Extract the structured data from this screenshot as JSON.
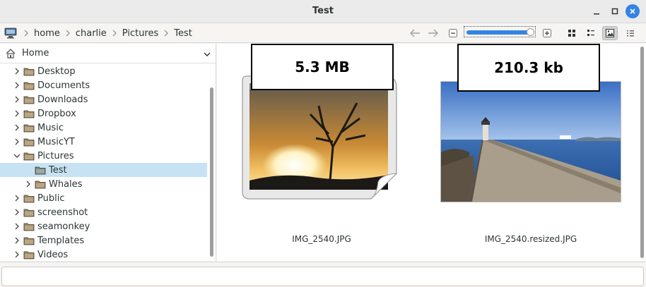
{
  "window": {
    "title": "Test"
  },
  "breadcrumb": [
    "home",
    "charlie",
    "Pictures",
    "Test"
  ],
  "zoom": {
    "level": 0.95
  },
  "sidebar": {
    "header": "Home",
    "items": [
      {
        "label": "Desktop",
        "depth": 1,
        "expanded": false,
        "selected": false
      },
      {
        "label": "Documents",
        "depth": 1,
        "expanded": false,
        "selected": false
      },
      {
        "label": "Downloads",
        "depth": 1,
        "expanded": false,
        "selected": false
      },
      {
        "label": "Dropbox",
        "depth": 1,
        "expanded": false,
        "selected": false
      },
      {
        "label": "Music",
        "depth": 1,
        "expanded": false,
        "selected": false
      },
      {
        "label": "MusicYT",
        "depth": 1,
        "expanded": false,
        "selected": false
      },
      {
        "label": "Pictures",
        "depth": 1,
        "expanded": true,
        "selected": false
      },
      {
        "label": "Test",
        "depth": 2,
        "expanded": null,
        "selected": true
      },
      {
        "label": "Whales",
        "depth": 2,
        "expanded": false,
        "selected": false
      },
      {
        "label": "Public",
        "depth": 1,
        "expanded": false,
        "selected": false
      },
      {
        "label": "screenshot",
        "depth": 1,
        "expanded": false,
        "selected": false
      },
      {
        "label": "seamonkey",
        "depth": 1,
        "expanded": false,
        "selected": false
      },
      {
        "label": "Templates",
        "depth": 1,
        "expanded": false,
        "selected": false
      },
      {
        "label": "Videos",
        "depth": 1,
        "expanded": false,
        "selected": false
      }
    ]
  },
  "files": [
    {
      "name": "IMG_2540.JPG",
      "size_label": "5.3 MB",
      "thumb": "generic-image-icon"
    },
    {
      "name": "IMG_2540.resized.JPG",
      "size_label": "210.3 kb",
      "thumb": "pier-photo"
    }
  ],
  "colors": {
    "accent": "#3584e4",
    "selection": "#c7e3f3",
    "folder": "#9c8a6e"
  }
}
